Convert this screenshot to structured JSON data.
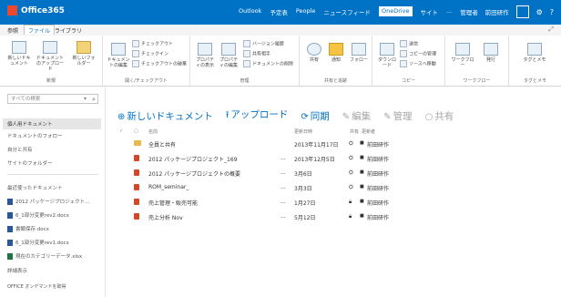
{
  "topbar": {
    "logo": "Office365",
    "nav": [
      "Outlook",
      "予定表",
      "People",
      "ニュースフィード",
      "OneDrive",
      "サイト",
      "...",
      "管理者"
    ],
    "active_nav": "OneDrive",
    "user": "前田研作",
    "settings_icon": "gear-icon",
    "help": "?"
  },
  "tabs": {
    "items": [
      "参照",
      "ファイル",
      "ライブラリ"
    ],
    "active": "ファイル"
  },
  "ribbon": {
    "groups": [
      {
        "label": "新規",
        "buttons": [
          "新しいドキュメント",
          "ドキュメントのアップロード",
          "新しいフォルダー"
        ]
      },
      {
        "label": "開く/チェックアウト",
        "buttons": [
          "ドキュメントの編集",
          "チェックアウト",
          "チェックイン",
          "チェックアウトの破棄"
        ]
      },
      {
        "label": "管理",
        "buttons": [
          "プロパティの表示",
          "プロパティの編集",
          "バージョン履歴",
          "共有相手",
          "ドキュメントの削除"
        ]
      },
      {
        "label": "共有と追跡",
        "buttons": [
          "共有",
          "通知",
          "フォロー"
        ]
      },
      {
        "label": "コピー",
        "buttons": [
          "ダウンロード",
          "送信",
          "コピーの管理",
          "ソースへ移動"
        ]
      },
      {
        "label": "ワークフロー",
        "buttons": [
          "ワークフロー",
          "発行"
        ]
      },
      {
        "label": "タグとメモ",
        "buttons": [
          "タグとメモ"
        ]
      }
    ]
  },
  "leftnav": {
    "search_placeholder": "すべての検索",
    "items": [
      "個人用ドキュメント",
      "ドキュメントのフォロー",
      "自分と共有",
      "サイトのフォルダー"
    ],
    "selected": "個人用ドキュメント",
    "recent_header": "最近使ったドキュメント",
    "recent": [
      {
        "name": "2012 パッケージプロジェクト...",
        "type": "word"
      },
      {
        "name": "6_1部分変更rev2.docx",
        "type": "word"
      },
      {
        "name": "書類保存.docx",
        "type": "word"
      },
      {
        "name": "6_1部分変更rev1.docx",
        "type": "word"
      },
      {
        "name": "現在のカテゴリーデータ.xlsx",
        "type": "excel"
      }
    ],
    "more": "詳細表示",
    "footer": "OFFICE オンデマンドを取得"
  },
  "commands": {
    "new_doc": "新しいドキュメント",
    "upload": "アップロード",
    "sync": "同期",
    "edit": "編集",
    "manage": "管理",
    "share": "共有"
  },
  "table": {
    "headers": {
      "name": "名前",
      "modified": "更新日時",
      "sharing": "共有",
      "modified_by": "更新者"
    },
    "rows": [
      {
        "name": "全員と共有",
        "type": "folder",
        "modified": "2013年11月17日",
        "sharing_icon": "people-icon",
        "modified_by": "前田研作"
      },
      {
        "name": "2012 パッケージプロジェクト_169",
        "type": "ppt",
        "more": "...",
        "modified": "2013年12月5日",
        "sharing_icon": "people-icon",
        "modified_by": "前田研作"
      },
      {
        "name": "2012 パッケージプロジェクトの概要",
        "type": "ppt",
        "more": "...",
        "modified": "3月6日",
        "sharing_icon": "people-icon",
        "modified_by": "前田研作"
      },
      {
        "name": "ROM_seminar_",
        "type": "ppt",
        "more": "...",
        "modified": "3月3日",
        "sharing_icon": "people-icon",
        "modified_by": "前田研作"
      },
      {
        "name": "売上管理・販売可能",
        "type": "ppt",
        "more": "...",
        "modified": "1月27日",
        "sharing_icon": "lock-icon",
        "modified_by": "前田研作"
      },
      {
        "name": "売上分析 Nov",
        "type": "ppt",
        "more": "...",
        "modified": "5月12日",
        "sharing_icon": "lock-icon",
        "modified_by": "前田研作"
      }
    ]
  },
  "colors": {
    "brand_blue": "#0072c6",
    "folder": "#e8b94b",
    "ppt": "#d24726",
    "word": "#2b5797",
    "excel": "#207245"
  }
}
